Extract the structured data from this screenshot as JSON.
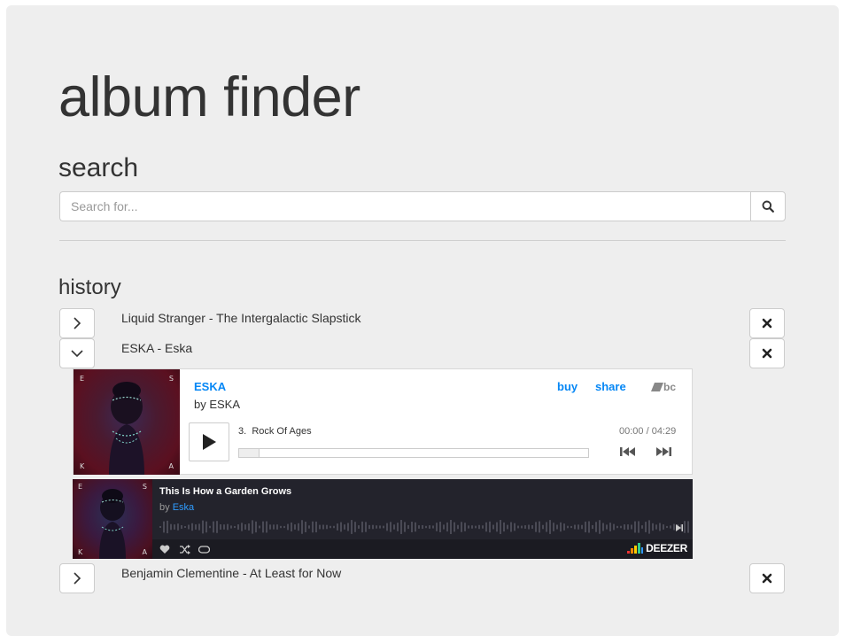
{
  "page": {
    "title": "album finder"
  },
  "search": {
    "heading": "search",
    "placeholder": "Search for...",
    "value": ""
  },
  "history": {
    "heading": "history",
    "items": [
      {
        "label": "Liquid Stranger - The Intergalactic Slapstick",
        "expanded": false
      },
      {
        "label": "ESKA - Eska",
        "expanded": true
      },
      {
        "label": "Benjamin Clementine - At Least for Now",
        "expanded": false
      }
    ]
  },
  "bandcamp_player": {
    "album": "ESKA",
    "by": "by ESKA",
    "buy_label": "buy",
    "share_label": "share",
    "logo": "bc",
    "track_number": "3.",
    "track_title": "Rock Of Ages",
    "time": "00:00 / 04:29",
    "progress_fraction": 0.0,
    "art_letters": [
      "E",
      "S",
      "K",
      "A"
    ]
  },
  "deezer_player": {
    "title": "This Is How a Garden Grows",
    "by_prefix": "by",
    "artist": "Eska",
    "logo": "DEEZER",
    "art_letters": [
      "E",
      "S",
      "K",
      "A"
    ]
  },
  "colors": {
    "panel_bg": "#eeeeee",
    "link_blue": "#0687f5",
    "deezer_bg": "#23232c",
    "deezer_link": "#2f9cff"
  },
  "icons": {
    "search_button": "magnifier-icon",
    "collapsed": "chevron-right-icon",
    "expanded": "chevron-down-icon",
    "remove": "close-icon"
  }
}
